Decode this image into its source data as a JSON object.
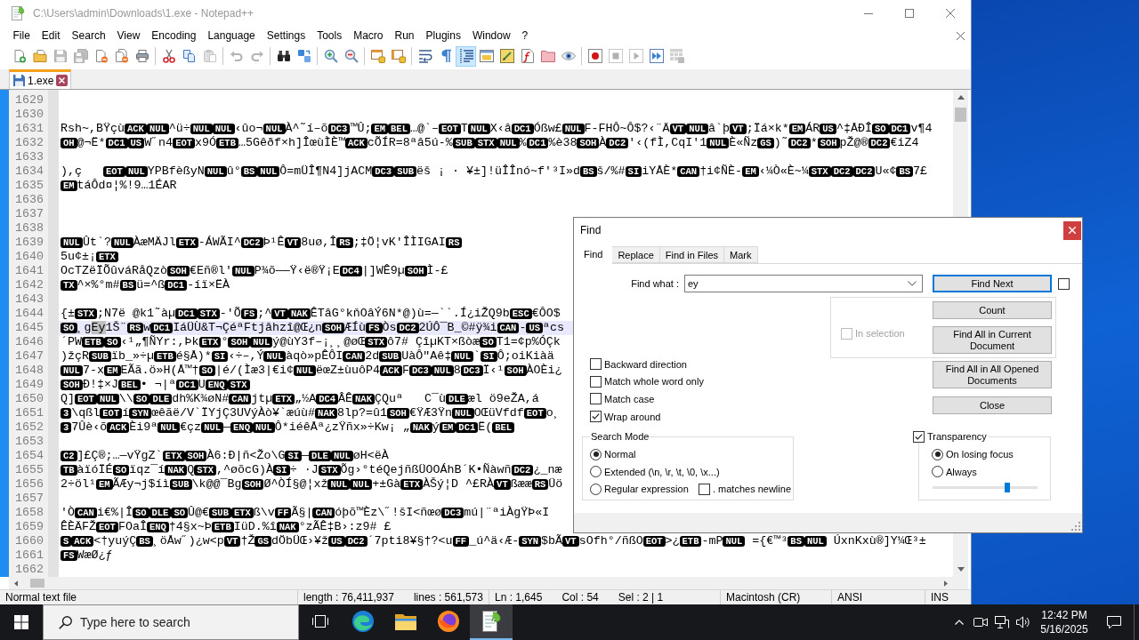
{
  "window": {
    "title": "C:\\Users\\admin\\Downloads\\1.exe - Notepad++",
    "focused": false
  },
  "menu": [
    "File",
    "Edit",
    "Search",
    "View",
    "Encoding",
    "Language",
    "Settings",
    "Tools",
    "Macro",
    "Run",
    "Plugins",
    "Window",
    "?"
  ],
  "toolbar": [
    [
      {
        "disabled": false,
        "pressed": false
      },
      {
        "disabled": false,
        "pressed": false
      },
      {
        "disabled": true,
        "pressed": false
      },
      {
        "disabled": true,
        "pressed": false
      },
      {
        "disabled": false,
        "pressed": false
      },
      {
        "disabled": false,
        "pressed": false
      },
      {
        "disabled": false,
        "pressed": false
      }
    ],
    [
      {
        "disabled": false,
        "pressed": false
      },
      {
        "disabled": false,
        "pressed": false
      },
      {
        "disabled": true,
        "pressed": false
      }
    ],
    [
      {
        "disabled": true,
        "pressed": false
      },
      {
        "disabled": true,
        "pressed": false
      }
    ],
    [
      {
        "disabled": false,
        "pressed": false
      },
      {
        "disabled": false,
        "pressed": false
      }
    ],
    [
      {
        "disabled": false,
        "pressed": false
      },
      {
        "disabled": false,
        "pressed": false
      }
    ],
    [
      {
        "disabled": false,
        "pressed": false
      },
      {
        "disabled": false,
        "pressed": false
      }
    ],
    [
      {
        "disabled": false,
        "pressed": false
      },
      {
        "disabled": false,
        "pressed": false
      },
      {
        "disabled": false,
        "pressed": true
      },
      {
        "disabled": false,
        "pressed": false
      },
      {
        "disabled": false,
        "pressed": false
      },
      {
        "disabled": false,
        "pressed": false
      },
      {
        "disabled": false,
        "pressed": false
      },
      {
        "disabled": false,
        "pressed": false
      }
    ],
    [
      {
        "disabled": false,
        "pressed": false
      },
      {
        "disabled": true,
        "pressed": false
      },
      {
        "disabled": true,
        "pressed": false
      },
      {
        "disabled": false,
        "pressed": false
      },
      {
        "disabled": true,
        "pressed": false
      }
    ]
  ],
  "tabs": [
    {
      "label": "1.exe",
      "selected": true,
      "modified": false
    }
  ],
  "editor": {
    "lines": [
      {
        "number": "1629",
        "current": false
      },
      {
        "number": "1630",
        "current": false
      },
      {
        "number": "1631",
        "current": false,
        "segments": [
          {
            "kind": "text",
            "text": "Rsh~,BŸçù"
          },
          {
            "kind": "control",
            "text": "ACK"
          },
          {
            "kind": "control",
            "text": "NUL"
          },
          {
            "kind": "text",
            "text": "^ü÷"
          },
          {
            "kind": "control",
            "text": "NUL"
          },
          {
            "kind": "control",
            "text": "NUL"
          },
          {
            "kind": "text",
            "text": "‹ûo¬"
          },
          {
            "kind": "control",
            "text": "NUL"
          },
          {
            "kind": "text",
            "text": "À^˜í–õ"
          },
          {
            "kind": "control",
            "text": "DC3"
          },
          {
            "kind": "text",
            "text": "™Û;"
          },
          {
            "kind": "control",
            "text": "EM"
          },
          {
            "kind": "control",
            "text": "BEL"
          },
          {
            "kind": "text",
            "text": "…@`–"
          },
          {
            "kind": "control",
            "text": "EOT"
          },
          {
            "kind": "text",
            "text": "T"
          },
          {
            "kind": "control",
            "text": "NUL"
          },
          {
            "kind": "text",
            "text": "X‹â"
          },
          {
            "kind": "control",
            "text": "DC1"
          },
          {
            "kind": "text",
            "text": "Óßw£"
          },
          {
            "kind": "control",
            "text": "NUL"
          },
          {
            "kind": "text",
            "text": "F-FHÔ~Ô$?‹¨Ä"
          },
          {
            "kind": "control",
            "text": "VT"
          },
          {
            "kind": "control",
            "text": "NUL"
          },
          {
            "kind": "text",
            "text": "â`þ"
          },
          {
            "kind": "control",
            "text": "VT"
          },
          {
            "kind": "text",
            "text": ";Ïá×k*"
          },
          {
            "kind": "control",
            "text": "EM"
          },
          {
            "kind": "text",
            "text": "ÁR"
          },
          {
            "kind": "control",
            "text": "US"
          },
          {
            "kind": "text",
            "text": "^‡ÅÐÎ"
          },
          {
            "kind": "control",
            "text": "SO"
          },
          {
            "kind": "control",
            "text": "DC1"
          },
          {
            "kind": "text",
            "text": "v¶4"
          }
        ]
      },
      {
        "number": "1632",
        "current": false,
        "segments": [
          {
            "kind": "control",
            "text": "OH"
          },
          {
            "kind": "text",
            "text": "@¬Ë*"
          },
          {
            "kind": "control",
            "text": "DC1"
          },
          {
            "kind": "control",
            "text": "US"
          },
          {
            "kind": "text",
            "text": "W˝n4"
          },
          {
            "kind": "control",
            "text": "EOT"
          },
          {
            "kind": "text",
            "text": "x9Ó"
          },
          {
            "kind": "control",
            "text": "ETB"
          },
          {
            "kind": "text",
            "text": "…5Gêðf×h]ÎœùÌÈ™"
          },
          {
            "kind": "control",
            "text": "ACK"
          },
          {
            "kind": "text",
            "text": "cÕÍR=8ªâ5ú-%"
          },
          {
            "kind": "control",
            "text": "SUB"
          },
          {
            "kind": "control",
            "text": "STX"
          },
          {
            "kind": "control",
            "text": "NUL"
          },
          {
            "kind": "text",
            "text": "%"
          },
          {
            "kind": "control",
            "text": "DC1"
          },
          {
            "kind": "text",
            "text": "%è38"
          },
          {
            "kind": "control",
            "text": "SOH"
          },
          {
            "kind": "text",
            "text": "À"
          },
          {
            "kind": "control",
            "text": "DC2"
          },
          {
            "kind": "text",
            "text": "'‹(fÌ,CqI'1"
          },
          {
            "kind": "control",
            "text": "NUL"
          },
          {
            "kind": "text",
            "text": "È«Ñz"
          },
          {
            "kind": "control",
            "text": "GS"
          },
          {
            "kind": "text",
            "text": ")˜"
          },
          {
            "kind": "control",
            "text": "DC2"
          },
          {
            "kind": "text",
            "text": "*"
          },
          {
            "kind": "control",
            "text": "SOH"
          },
          {
            "kind": "text",
            "text": "pŽ@®"
          },
          {
            "kind": "control",
            "text": "DC2"
          },
          {
            "kind": "text",
            "text": "€iZ4"
          }
        ]
      },
      {
        "number": "1633",
        "current": false
      },
      {
        "number": "1634",
        "current": false,
        "segments": [
          {
            "kind": "text",
            "text": "),ç   "
          },
          {
            "kind": "control",
            "text": "EOT"
          },
          {
            "kind": "control",
            "text": "NUL"
          },
          {
            "kind": "text",
            "text": "YPBfèßyN"
          },
          {
            "kind": "control",
            "text": "NUL"
          },
          {
            "kind": "text",
            "text": "û°"
          },
          {
            "kind": "control",
            "text": "BS"
          },
          {
            "kind": "control",
            "text": "NUL"
          },
          {
            "kind": "text",
            "text": "Ô=mÜÎ¶N4]jACM"
          },
          {
            "kind": "control",
            "text": "DC3"
          },
          {
            "kind": "control",
            "text": "SUB"
          },
          {
            "kind": "text",
            "text": "ëš ¡ · ¥±]!üÎÎnó~f'³I»d"
          },
          {
            "kind": "control",
            "text": "BS"
          },
          {
            "kind": "text",
            "text": "š/%#"
          },
          {
            "kind": "control",
            "text": "SI"
          },
          {
            "kind": "text",
            "text": "iYÅÈ*"
          },
          {
            "kind": "control",
            "text": "CAN"
          },
          {
            "kind": "text",
            "text": "†i¢ÑÈ-"
          },
          {
            "kind": "control",
            "text": "EM"
          },
          {
            "kind": "text",
            "text": "‹¼Ò«È~¼"
          },
          {
            "kind": "control",
            "text": "STX"
          },
          {
            "kind": "control",
            "text": "DC2"
          },
          {
            "kind": "control",
            "text": "DC2"
          },
          {
            "kind": "text",
            "text": "U«¢"
          },
          {
            "kind": "control",
            "text": "BS"
          },
          {
            "kind": "text",
            "text": "7£"
          }
        ]
      },
      {
        "number": "1635",
        "current": false,
        "segments": [
          {
            "kind": "control",
            "text": "EM"
          },
          {
            "kind": "text",
            "text": "táÔd¤¦%!9…1ÉAR"
          }
        ]
      },
      {
        "number": "1636",
        "current": false
      },
      {
        "number": "1637",
        "current": false
      },
      {
        "number": "1638",
        "current": false
      },
      {
        "number": "1639",
        "current": false,
        "segments": [
          {
            "kind": "control",
            "text": "NUL"
          },
          {
            "kind": "text",
            "text": "Ût`?"
          },
          {
            "kind": "control",
            "text": "NUL"
          },
          {
            "kind": "text",
            "text": "ÀæMÄJl"
          },
          {
            "kind": "control",
            "text": "ETX"
          },
          {
            "kind": "text",
            "text": "-ÁWÃI^"
          },
          {
            "kind": "control",
            "text": "DC2"
          },
          {
            "kind": "text",
            "text": "Þ¹Ê"
          },
          {
            "kind": "control",
            "text": "VT"
          },
          {
            "kind": "text",
            "text": "8uø,Î"
          },
          {
            "kind": "control",
            "text": "RS"
          },
          {
            "kind": "text",
            "text": ";‡Ö¦vK'ÎÌIGAI"
          },
          {
            "kind": "control",
            "text": "RS"
          }
        ]
      },
      {
        "number": "1640",
        "current": false,
        "segments": [
          {
            "kind": "text",
            "text": "5u¢±¡"
          },
          {
            "kind": "control",
            "text": "ETX"
          }
        ]
      },
      {
        "number": "1641",
        "current": false,
        "segments": [
          {
            "kind": "text",
            "text": "OcTZëÏÕûváRåQzò"
          },
          {
            "kind": "control",
            "text": "SOH"
          },
          {
            "kind": "text",
            "text": "€Eñ®l'"
          },
          {
            "kind": "control",
            "text": "NUL"
          },
          {
            "kind": "text",
            "text": "P¾õ——Ÿ‹ë®Ÿ¡E"
          },
          {
            "kind": "control",
            "text": "DC4"
          },
          {
            "kind": "text",
            "text": "|]WÊ9µ"
          },
          {
            "kind": "control",
            "text": "SOH"
          },
          {
            "kind": "text",
            "text": "Ì-£"
          }
        ]
      },
      {
        "number": "1642",
        "current": false,
        "segments": [
          {
            "kind": "control",
            "text": "TX"
          },
          {
            "kind": "text",
            "text": "^×%°m#"
          },
          {
            "kind": "control",
            "text": "BS"
          },
          {
            "kind": "text",
            "text": "ü=^ß"
          },
          {
            "kind": "control",
            "text": "DC1"
          },
          {
            "kind": "text",
            "text": "-íï×ËÀ"
          }
        ]
      },
      {
        "number": "1643",
        "current": false
      },
      {
        "number": "1644",
        "current": false,
        "segments": [
          {
            "kind": "text",
            "text": "{±"
          },
          {
            "kind": "control",
            "text": "STX"
          },
          {
            "kind": "text",
            "text": ";N7ë @k1˜àµ"
          },
          {
            "kind": "control",
            "text": "DC1"
          },
          {
            "kind": "control",
            "text": "STX"
          },
          {
            "kind": "text",
            "text": "-'Õ"
          },
          {
            "kind": "control",
            "text": "FS"
          },
          {
            "kind": "text",
            "text": ";^"
          },
          {
            "kind": "control",
            "text": "VT"
          },
          {
            "kind": "control",
            "text": "NAK"
          },
          {
            "kind": "text",
            "text": "ÊTâG°kňOâÝ6N*@)ù=—``.Í¿iŽQ9b"
          },
          {
            "kind": "control",
            "text": "ESC"
          },
          {
            "kind": "text",
            "text": "€ÔO$"
          }
        ]
      },
      {
        "number": "1645",
        "current": true,
        "segments": [
          {
            "kind": "control",
            "text": "SO"
          },
          {
            "kind": "text",
            "text": "¸g"
          },
          {
            "kind": "selection",
            "text": "Ey"
          },
          {
            "kind": "text",
            "text": "1Š¨"
          },
          {
            "kind": "control",
            "text": "RS"
          },
          {
            "kind": "text",
            "text": "w"
          },
          {
            "kind": "control",
            "text": "DC1"
          },
          {
            "kind": "text",
            "text": "IáÜÙ&T¬ÇéªFtjâhzî@Œ¿n"
          },
          {
            "kind": "control",
            "text": "SOH"
          },
          {
            "kind": "text",
            "text": "ÆÍù"
          },
          {
            "kind": "control",
            "text": "FS"
          },
          {
            "kind": "text",
            "text": "Òs"
          },
          {
            "kind": "control",
            "text": "DC2"
          },
          {
            "kind": "text",
            "text": "2ÚÔ¯B_©#ÿ¾i"
          },
          {
            "kind": "control",
            "text": "CAN"
          },
          {
            "kind": "text",
            "text": "-"
          },
          {
            "kind": "control",
            "text": "US"
          },
          {
            "kind": "text",
            "text": "ªcs"
          }
        ]
      },
      {
        "number": "1646",
        "current": false,
        "segments": [
          {
            "kind": "text",
            "text": "´PW"
          },
          {
            "kind": "control",
            "text": "ETB"
          },
          {
            "kind": "control",
            "text": "SO"
          },
          {
            "kind": "text",
            "text": "‹¹„¶ÑYr:,Þk"
          },
          {
            "kind": "control",
            "text": "ETX"
          },
          {
            "kind": "text",
            "text": "°"
          },
          {
            "kind": "control",
            "text": "SOH"
          },
          {
            "kind": "control",
            "text": "NUL"
          },
          {
            "kind": "text",
            "text": "ý@ùY3f–¡¸¸@øŒ"
          },
          {
            "kind": "control",
            "text": "STX"
          },
          {
            "kind": "text",
            "text": "ô7# ÇîµKT×ßòæ"
          },
          {
            "kind": "control",
            "text": "SO"
          },
          {
            "kind": "text",
            "text": "T1=¢p%ÓÇk"
          }
        ]
      },
      {
        "number": "1647",
        "current": false,
        "segments": [
          {
            "kind": "text",
            "text": ")žçR"
          },
          {
            "kind": "control",
            "text": "SUB"
          },
          {
            "kind": "text",
            "text": "ïb_»÷µ"
          },
          {
            "kind": "control",
            "text": "ETB"
          },
          {
            "kind": "text",
            "text": "é§Å)*"
          },
          {
            "kind": "control",
            "text": "SI"
          },
          {
            "kind": "text",
            "text": "‹÷–,Ý"
          },
          {
            "kind": "control",
            "text": "NUL"
          },
          {
            "kind": "text",
            "text": "àqò»pÊÔI"
          },
          {
            "kind": "control",
            "text": "CAN"
          },
          {
            "kind": "text",
            "text": "2d"
          },
          {
            "kind": "control",
            "text": "SUB"
          },
          {
            "kind": "text",
            "text": "UàÔ\"Aê‡"
          },
          {
            "kind": "control",
            "text": "NUL"
          },
          {
            "kind": "text",
            "text": "`"
          },
          {
            "kind": "control",
            "text": "SI"
          },
          {
            "kind": "text",
            "text": "Ô;oiKiàä"
          }
        ]
      },
      {
        "number": "1648",
        "current": false,
        "segments": [
          {
            "kind": "control",
            "text": "NUL"
          },
          {
            "kind": "text",
            "text": "7-x"
          },
          {
            "kind": "control",
            "text": "EM"
          },
          {
            "kind": "text",
            "text": "EÃã.ö»H(Å™†"
          },
          {
            "kind": "control",
            "text": "SO"
          },
          {
            "kind": "text",
            "text": "|é/(Ìæ3|€i¢"
          },
          {
            "kind": "control",
            "text": "NUL"
          },
          {
            "kind": "text",
            "text": "ëœZ±ùuôP4"
          },
          {
            "kind": "control",
            "text": "ACK"
          },
          {
            "kind": "text",
            "text": "F"
          },
          {
            "kind": "control",
            "text": "DC3"
          },
          {
            "kind": "control",
            "text": "NUL"
          },
          {
            "kind": "text",
            "text": "8"
          },
          {
            "kind": "control",
            "text": "DC3"
          },
          {
            "kind": "text",
            "text": "Ï‹¹"
          },
          {
            "kind": "control",
            "text": "SOH"
          },
          {
            "kind": "text",
            "text": "ÀOÈi¿"
          }
        ]
      },
      {
        "number": "1649",
        "current": false,
        "segments": [
          {
            "kind": "control",
            "text": "SOH"
          },
          {
            "kind": "text",
            "text": "Ð!‡×J"
          },
          {
            "kind": "control",
            "text": "BEL"
          },
          {
            "kind": "text",
            "text": "• ¬|ª"
          },
          {
            "kind": "control",
            "text": "DC1"
          },
          {
            "kind": "text",
            "text": "U"
          },
          {
            "kind": "control",
            "text": "ENQ"
          },
          {
            "kind": "control",
            "text": "STX"
          }
        ]
      },
      {
        "number": "1650",
        "current": false,
        "segments": [
          {
            "kind": "text",
            "text": "Q]"
          },
          {
            "kind": "control",
            "text": "EOT"
          },
          {
            "kind": "control",
            "text": "NUL"
          },
          {
            "kind": "text",
            "text": "\\\\"
          },
          {
            "kind": "control",
            "text": "SO"
          },
          {
            "kind": "control",
            "text": "DLE"
          },
          {
            "kind": "text",
            "text": "dh%K¾øN#"
          },
          {
            "kind": "control",
            "text": "CAN"
          },
          {
            "kind": "text",
            "text": "jtµ"
          },
          {
            "kind": "control",
            "text": "ETX"
          },
          {
            "kind": "text",
            "text": "„½A"
          },
          {
            "kind": "control",
            "text": "DC4"
          },
          {
            "kind": "text",
            "text": "ÂÊ"
          },
          {
            "kind": "control",
            "text": "NAK"
          },
          {
            "kind": "text",
            "text": "ÇQuª   C¯ù"
          },
          {
            "kind": "control",
            "text": "DLE"
          },
          {
            "kind": "text",
            "text": "æl ö9eŽA,á"
          }
        ]
      },
      {
        "number": "1651",
        "current": false,
        "segments": [
          {
            "kind": "control",
            "text": "3"
          },
          {
            "kind": "text",
            "text": "\\qßl"
          },
          {
            "kind": "control",
            "text": "EOT"
          },
          {
            "kind": "text",
            "text": "í"
          },
          {
            "kind": "control",
            "text": "SYN"
          },
          {
            "kind": "text",
            "text": "œêãë/V`ÏYjÇ3UVýÀò¥`æúù#"
          },
          {
            "kind": "control",
            "text": "NAK"
          },
          {
            "kind": "text",
            "text": "8lp?=û1"
          },
          {
            "kind": "control",
            "text": "SOH"
          },
          {
            "kind": "text",
            "text": "€ŸÆ3Ÿn"
          },
          {
            "kind": "control",
            "text": "NUL"
          },
          {
            "kind": "text",
            "text": "OŒüVfdf"
          },
          {
            "kind": "control",
            "text": "EOT"
          },
          {
            "kind": "text",
            "text": "o¸"
          }
        ]
      },
      {
        "number": "1652",
        "current": false,
        "segments": [
          {
            "kind": "control",
            "text": "3"
          },
          {
            "kind": "text",
            "text": "7Ûè‹õ"
          },
          {
            "kind": "control",
            "text": "ACK"
          },
          {
            "kind": "text",
            "text": "Èi9ª"
          },
          {
            "kind": "control",
            "text": "NUL"
          },
          {
            "kind": "text",
            "text": "€çz"
          },
          {
            "kind": "control",
            "text": "NUL"
          },
          {
            "kind": "text",
            "text": "—"
          },
          {
            "kind": "control",
            "text": "ENQ"
          },
          {
            "kind": "control",
            "text": "NUL"
          },
          {
            "kind": "text",
            "text": "Ô*iéêÅª¿zŸñx»÷Kw¡ „"
          },
          {
            "kind": "control",
            "text": "NAK"
          },
          {
            "kind": "text",
            "text": "ý"
          },
          {
            "kind": "control",
            "text": "EM"
          },
          {
            "kind": "control",
            "text": "DC1"
          },
          {
            "kind": "text",
            "text": "Ë("
          },
          {
            "kind": "control",
            "text": "BEL"
          }
        ]
      },
      {
        "number": "1653",
        "current": false
      },
      {
        "number": "1654",
        "current": false,
        "segments": [
          {
            "kind": "control",
            "text": "C2"
          },
          {
            "kind": "text",
            "text": "]£Ç®;…—vŸgZ`"
          },
          {
            "kind": "control",
            "text": "ETX"
          },
          {
            "kind": "control",
            "text": "SOH"
          },
          {
            "kind": "text",
            "text": "À6:Ð|ñ<Žo\\G"
          },
          {
            "kind": "control",
            "text": "SI"
          },
          {
            "kind": "text",
            "text": "—"
          },
          {
            "kind": "control",
            "text": "DLE"
          },
          {
            "kind": "control",
            "text": "NUL"
          },
          {
            "kind": "text",
            "text": "øH<ëÀ"
          }
        ]
      },
      {
        "number": "1655",
        "current": false,
        "segments": [
          {
            "kind": "control",
            "text": "TB"
          },
          {
            "kind": "text",
            "text": "àïóÏÉ"
          },
          {
            "kind": "control",
            "text": "SO"
          },
          {
            "kind": "text",
            "text": "ïqz¯í"
          },
          {
            "kind": "control",
            "text": "NAK"
          },
          {
            "kind": "text",
            "text": "Q"
          },
          {
            "kind": "control",
            "text": "STX"
          },
          {
            "kind": "text",
            "text": ",^øõcG)À"
          },
          {
            "kind": "control",
            "text": "SI"
          },
          {
            "kind": "text",
            "text": "÷ ·J"
          },
          {
            "kind": "control",
            "text": "STX"
          },
          {
            "kind": "text",
            "text": "Õg›°téQejñßÜOOÁhB´K•Ñàwñ"
          },
          {
            "kind": "control",
            "text": "DC2"
          },
          {
            "kind": "text",
            "text": "¿_næ"
          }
        ]
      },
      {
        "number": "1656",
        "current": false,
        "segments": [
          {
            "kind": "text",
            "text": "2÷öl¹"
          },
          {
            "kind": "control",
            "text": "EM"
          },
          {
            "kind": "text",
            "text": "ÃÆy¬j$íì"
          },
          {
            "kind": "control",
            "text": "SUB"
          },
          {
            "kind": "text",
            "text": "\\k@@¯Bg"
          },
          {
            "kind": "control",
            "text": "SOH"
          },
          {
            "kind": "text",
            "text": "Ø^ÒÍ§@¦xž"
          },
          {
            "kind": "control",
            "text": "NUL"
          },
          {
            "kind": "control",
            "text": "NUL"
          },
          {
            "kind": "text",
            "text": "+±Gà"
          },
          {
            "kind": "control",
            "text": "ETX"
          },
          {
            "kind": "text",
            "text": "ÀŠý¦D ^£RÀ"
          },
          {
            "kind": "control",
            "text": "VT"
          },
          {
            "kind": "text",
            "text": "ßææ"
          },
          {
            "kind": "control",
            "text": "RS"
          },
          {
            "kind": "text",
            "text": "Üö"
          }
        ]
      },
      {
        "number": "1657",
        "current": false
      },
      {
        "number": "1658",
        "current": false,
        "segments": [
          {
            "kind": "text",
            "text": "'Ò"
          },
          {
            "kind": "control",
            "text": "CAN"
          },
          {
            "kind": "text",
            "text": "i€%|Î"
          },
          {
            "kind": "control",
            "text": "SO"
          },
          {
            "kind": "control",
            "text": "DLE"
          },
          {
            "kind": "control",
            "text": "SO"
          },
          {
            "kind": "text",
            "text": "Û@€"
          },
          {
            "kind": "control",
            "text": "SUB"
          },
          {
            "kind": "control",
            "text": "ETX"
          },
          {
            "kind": "text",
            "text": "ß\\v"
          },
          {
            "kind": "control",
            "text": "FF"
          },
          {
            "kind": "text",
            "text": "Ã"
          },
          {
            "kind": "text",
            "text": "§|"
          },
          {
            "kind": "control",
            "text": "CAN"
          },
          {
            "kind": "text",
            "text": "óþõ™Èz\\˝!šI<ñœø"
          },
          {
            "kind": "control",
            "text": "DC3"
          },
          {
            "kind": "text",
            "text": "mú|¨ªiÀgŸÞ«I"
          }
        ]
      },
      {
        "number": "1659",
        "current": false,
        "segments": [
          {
            "kind": "text",
            "text": "ÊÈÄFŽ"
          },
          {
            "kind": "control",
            "text": "EOT"
          },
          {
            "kind": "text",
            "text": "FOaÎ"
          },
          {
            "kind": "control",
            "text": "ENQ"
          },
          {
            "kind": "text",
            "text": "†4§x~Þ"
          },
          {
            "kind": "control",
            "text": "ETB"
          },
          {
            "kind": "text",
            "text": "IüD.%î"
          },
          {
            "kind": "control",
            "text": "NAK"
          },
          {
            "kind": "text",
            "text": "°zÃÊ‡B›:z9# £"
          }
        ]
      },
      {
        "number": "1660",
        "current": false,
        "segments": [
          {
            "kind": "control",
            "text": "S"
          },
          {
            "kind": "control",
            "text": "ACK"
          },
          {
            "kind": "text",
            "text": "<†yuýÇ"
          },
          {
            "kind": "control",
            "text": "BS"
          },
          {
            "kind": "text",
            "text": "¸öÅw˝)¿w<p"
          },
          {
            "kind": "control",
            "text": "VT"
          },
          {
            "kind": "text",
            "text": "†Ž"
          },
          {
            "kind": "control",
            "text": "GS"
          },
          {
            "kind": "text",
            "text": "dÖbÜŒ›¥ž"
          },
          {
            "kind": "control",
            "text": "US"
          },
          {
            "kind": "control",
            "text": "DC2"
          },
          {
            "kind": "text",
            "text": "´7pti8¥§†?<u"
          },
          {
            "kind": "control",
            "text": "FF"
          },
          {
            "kind": "text",
            "text": "_ú^ä‹Æ-"
          },
          {
            "kind": "control",
            "text": "SYN"
          },
          {
            "kind": "text",
            "text": "$bÃ"
          },
          {
            "kind": "control",
            "text": "VT"
          },
          {
            "kind": "text",
            "text": "sOfh°/ñßO"
          },
          {
            "kind": "control",
            "text": "EOT"
          },
          {
            "kind": "text",
            "text": ">¿"
          },
          {
            "kind": "control",
            "text": "ETB"
          },
          {
            "kind": "text",
            "text": "-mP"
          },
          {
            "kind": "control",
            "text": "NUL"
          },
          {
            "kind": "text",
            "text": " ={€™³"
          },
          {
            "kind": "control",
            "text": "BS"
          },
          {
            "kind": "control",
            "text": "NUL"
          },
          {
            "kind": "text",
            "text": " ÚxnKxù®]Y¼Œ³±"
          }
        ]
      },
      {
        "number": "1661",
        "current": false,
        "segments": [
          {
            "kind": "control",
            "text": "FS"
          },
          {
            "kind": "text",
            "text": "WæØ¿ƒ"
          }
        ]
      },
      {
        "number": "1662",
        "current": false
      }
    ]
  },
  "status_bar": [
    [
      "Normal text file"
    ],
    [
      "length : 76,411,937",
      "lines : 561,573"
    ],
    [
      "Ln : 1,645",
      "Col : 54",
      "Sel : 2 | 1"
    ],
    [
      "Macintosh (CR)"
    ],
    [
      "ANSI"
    ],
    [
      "INS"
    ]
  ],
  "find_dialog": {
    "title": "Find",
    "tabs": [
      {
        "label": "Find",
        "selected": true
      },
      {
        "label": "Replace",
        "selected": false
      },
      {
        "label": "Find in Files",
        "selected": false
      },
      {
        "label": "Mark",
        "selected": false
      }
    ],
    "find_what": {
      "label": "Find what :",
      "value": "ey"
    },
    "find_next": {
      "label": "Find Next",
      "default": true
    },
    "extra_checkbox": {
      "checked": false
    },
    "in_selection": {
      "label": "In selection",
      "checked": false,
      "disabled": true
    },
    "count_button": "Count",
    "find_all_current_button": "Find All in Current Document",
    "find_all_opened_button": "Find All in All Opened Documents",
    "close_button": "Close",
    "options": [
      {
        "label": "Backward direction",
        "checked": false
      },
      {
        "label": "Match whole word only",
        "checked": false
      },
      {
        "label": "Match case",
        "checked": false
      },
      {
        "label": "Wrap around",
        "checked": true
      }
    ],
    "search_mode": {
      "title": "Search Mode",
      "modes": [
        {
          "label": "Normal",
          "selected": true
        },
        {
          "label": "Extended (\\n, \\r, \\t, \\0, \\x...)",
          "selected": false
        },
        {
          "label": "Regular expression",
          "selected": false
        }
      ],
      "dot_matches_newline": {
        "label": ". matches newline",
        "checked": false
      }
    },
    "transparency": {
      "label": "Transparency",
      "checked": true,
      "modes": [
        {
          "label": "On losing focus",
          "selected": true
        },
        {
          "label": "Always",
          "selected": false
        }
      ],
      "level": 0.71
    }
  },
  "taskbar": {
    "search": {
      "placeholder": "Type here to search"
    },
    "apps": [
      {
        "active": false
      },
      {
        "active": false
      },
      {
        "active": false
      },
      {
        "active": true
      }
    ],
    "clock": {
      "time": "12:42 PM",
      "date": "5/16/2025"
    }
  }
}
